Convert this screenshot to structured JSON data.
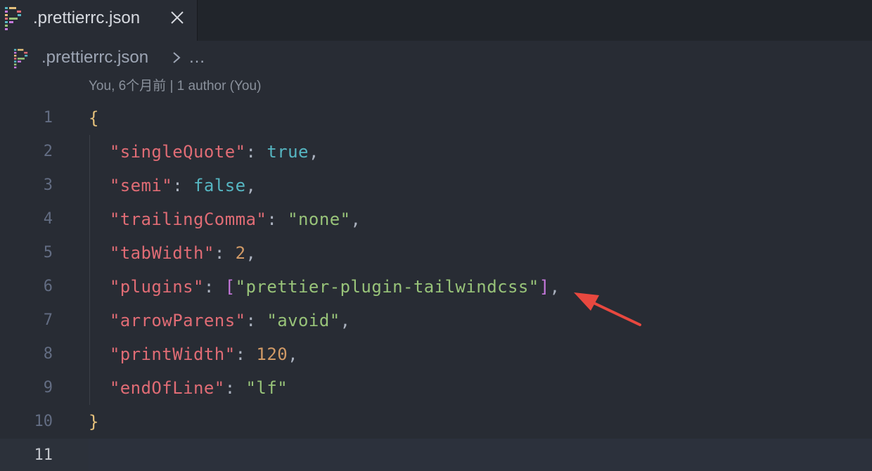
{
  "tab": {
    "icon": "prettier-icon",
    "label": ".prettierrc.json",
    "close_icon": "close-icon"
  },
  "breadcrumb": {
    "icon": "prettier-icon",
    "file": ".prettierrc.json",
    "separator_icon": "chevron-right-icon",
    "more": "…"
  },
  "blame": "You, 6个月前 | 1 author (You)",
  "lines": [
    {
      "num": "1"
    },
    {
      "num": "2"
    },
    {
      "num": "3"
    },
    {
      "num": "4"
    },
    {
      "num": "5"
    },
    {
      "num": "6"
    },
    {
      "num": "7"
    },
    {
      "num": "8"
    },
    {
      "num": "9"
    },
    {
      "num": "10"
    },
    {
      "num": "11"
    }
  ],
  "code": {
    "open_brace": "{",
    "close_brace": "}",
    "l2": {
      "key": "\"singleQuote\"",
      "sep": ": ",
      "val": "true",
      "end": ","
    },
    "l3": {
      "key": "\"semi\"",
      "sep": ": ",
      "val": "false",
      "end": ","
    },
    "l4": {
      "key": "\"trailingComma\"",
      "sep": ": ",
      "val": "\"none\"",
      "end": ","
    },
    "l5": {
      "key": "\"tabWidth\"",
      "sep": ": ",
      "val": "2",
      "end": ","
    },
    "l6": {
      "key": "\"plugins\"",
      "sep": ": ",
      "open": "[",
      "val": "\"prettier-plugin-tailwindcss\"",
      "close": "]",
      "end": ","
    },
    "l7": {
      "key": "\"arrowParens\"",
      "sep": ": ",
      "val": "\"avoid\"",
      "end": ","
    },
    "l8": {
      "key": "\"printWidth\"",
      "sep": ": ",
      "val": "120",
      "end": ","
    },
    "l9": {
      "key": "\"endOfLine\"",
      "sep": ": ",
      "val": "\"lf\"",
      "end": ""
    }
  },
  "colors": {
    "key": "#e06c75",
    "string": "#98c379",
    "boolean": "#56b6c2",
    "number": "#d19a66",
    "brace": "#e5c07b",
    "bracket": "#c678dd",
    "annotation_arrow": "#e8483f"
  },
  "annotation": {
    "icon": "arrow-annotation-icon"
  }
}
